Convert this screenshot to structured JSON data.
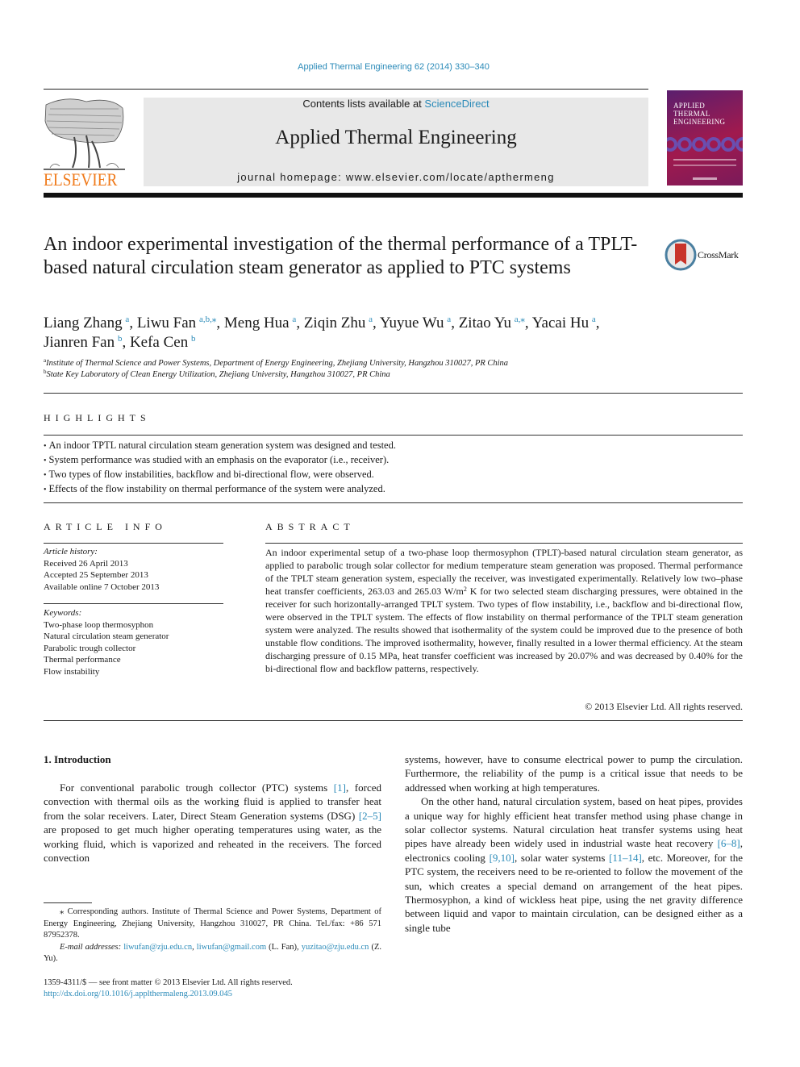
{
  "header": {
    "citation": "Applied Thermal Engineering 62 (2014) 330–340",
    "contents_prefix": "Contents lists available at ",
    "contents_link": "ScienceDirect",
    "journal_name": "Applied Thermal Engineering",
    "homepage": "journal homepage: www.elsevier.com/locate/apthermeng",
    "publisher_logo_text": "ELSEVIER",
    "cover_title_lines": [
      "APPLIED",
      "THERMAL",
      "ENGINEERING"
    ],
    "crossmark_label": "CrossMark",
    "colors": {
      "link": "#2a8ab8",
      "elsevier_orange": "#f07a1a",
      "masthead_bg": "#e8e8e8"
    }
  },
  "article": {
    "title": "An indoor experimental investigation of the thermal performance of a TPLT-based natural circulation steam generator as applied to PTC systems",
    "authors": [
      {
        "name": "Liang Zhang",
        "aff": "a",
        "sep": ", "
      },
      {
        "name": "Liwu Fan",
        "aff": "a,b,⁎",
        "sep": ", "
      },
      {
        "name": "Meng Hua",
        "aff": "a",
        "sep": ", "
      },
      {
        "name": "Ziqin Zhu",
        "aff": "a",
        "sep": ", "
      },
      {
        "name": "Yuyue Wu",
        "aff": "a",
        "sep": ", "
      },
      {
        "name": "Zitao Yu",
        "aff": "a,⁎",
        "sep": ", "
      },
      {
        "name": "Yacai Hu",
        "aff": "a",
        "sep": ","
      },
      {
        "name": "Jianren Fan",
        "aff": "b",
        "sep": ", "
      },
      {
        "name": "Kefa Cen",
        "aff": "b",
        "sep": ""
      }
    ],
    "affiliations": [
      {
        "key": "a",
        "text": "Institute of Thermal Science and Power Systems, Department of Energy Engineering, Zhejiang University, Hangzhou 310027, PR China"
      },
      {
        "key": "b",
        "text": "State Key Laboratory of Clean Energy Utilization, Zhejiang University, Hangzhou 310027, PR China"
      }
    ]
  },
  "highlights": {
    "heading": "HIGHLIGHTS",
    "items": [
      "An indoor TPTL natural circulation steam generation system was designed and tested.",
      "System performance was studied with an emphasis on the evaporator (i.e., receiver).",
      "Two types of flow instabilities, backflow and bi-directional flow, were observed.",
      "Effects of the flow instability on thermal performance of the system were analyzed."
    ]
  },
  "article_info": {
    "heading": "ARTICLE INFO",
    "history_label": "Article history:",
    "history": [
      "Received 26 April 2013",
      "Accepted 25 September 2013",
      "Available online 7 October 2013"
    ],
    "keywords_label": "Keywords:",
    "keywords": [
      "Two-phase loop thermosyphon",
      "Natural circulation steam generator",
      "Parabolic trough collector",
      "Thermal performance",
      "Flow instability"
    ]
  },
  "abstract": {
    "heading": "ABSTRACT",
    "text_part1": "An indoor experimental setup of a two-phase loop thermosyphon (TPLT)-based natural circulation steam generator, as applied to parabolic trough solar collector for medium temperature steam generation was proposed. Thermal performance of the TPLT steam generation system, especially the receiver, was investigated experimentally. Relatively low two–phase heat transfer coefficients, 263.03 and 265.03 W/m",
    "text_sup": "2",
    "text_part2": " K for two selected steam discharging pressures, were obtained in the receiver for such horizontally-arranged TPLT system. Two types of flow instability, i.e., backflow and bi-directional flow, were observed in the TPLT system. The effects of flow instability on thermal performance of the TPLT steam generation system were analyzed. The results showed that isothermality of the system could be improved due to the presence of both unstable flow conditions. The improved isothermality, however, finally resulted in a lower thermal efficiency. At the steam discharging pressure of 0.15 MPa, heat transfer coefficient was increased by 20.07% and was decreased by 0.40% for the bi-directional flow and backflow patterns, respectively.",
    "copyright": "© 2013 Elsevier Ltd. All rights reserved."
  },
  "introduction": {
    "heading": "1.  Introduction",
    "left": {
      "p1_a": "For conventional parabolic trough collector (PTC) systems ",
      "ref1": "[1]",
      "p1_b": ", forced convection with thermal oils as the working fluid is applied to transfer heat from the solar receivers. Later, Direct Steam Generation systems (DSG) ",
      "ref2": "[2–5]",
      "p1_c": " are proposed to get much higher operating temperatures using water, as the working fluid, which is vaporized and reheated in the receivers. The forced convection"
    },
    "right": {
      "p1": "systems, however, have to consume electrical power to pump the circulation. Furthermore, the reliability of the pump is a critical issue that needs to be addressed when working at high temperatures.",
      "p2_a": "On the other hand, natural circulation system, based on heat pipes, provides a unique way for highly efficient heat transfer method using phase change in solar collector systems. Natural circulation heat transfer systems using heat pipes have already been widely used in industrial waste heat recovery ",
      "ref3": "[6–8]",
      "p2_b": ", electronics cooling ",
      "ref4": "[9,10]",
      "p2_c": ", solar water systems ",
      "ref5": "[11–14]",
      "p2_d": ", etc. Moreover, for the PTC system, the receivers need to be re-oriented to follow the movement of the sun, which creates a special demand on arrangement of the heat pipes. Thermosyphon, a kind of wickless heat pipe, using the net gravity difference between liquid and vapor to maintain circulation, can be designed either as a single tube"
    }
  },
  "footnote": {
    "corresponding": "⁎ Corresponding authors. Institute of Thermal Science and Power Systems, Department of Energy Engineering, Zhejiang University, Hangzhou 310027, PR China. Tel./fax: +86 571 87952378.",
    "email_label": "E-mail addresses:",
    "email1": "liwufan@zju.edu.cn",
    "email2": "liwufan@gmail.com",
    "email2_suffix": " (L. Fan), ",
    "email3": "yuzitao@zju.edu.cn",
    "email3_suffix": " (Z. Yu).",
    "issn": "1359-4311/$ — see front matter © 2013 Elsevier Ltd. All rights reserved.",
    "doi": "http://dx.doi.org/10.1016/j.applthermaleng.2013.09.045"
  }
}
